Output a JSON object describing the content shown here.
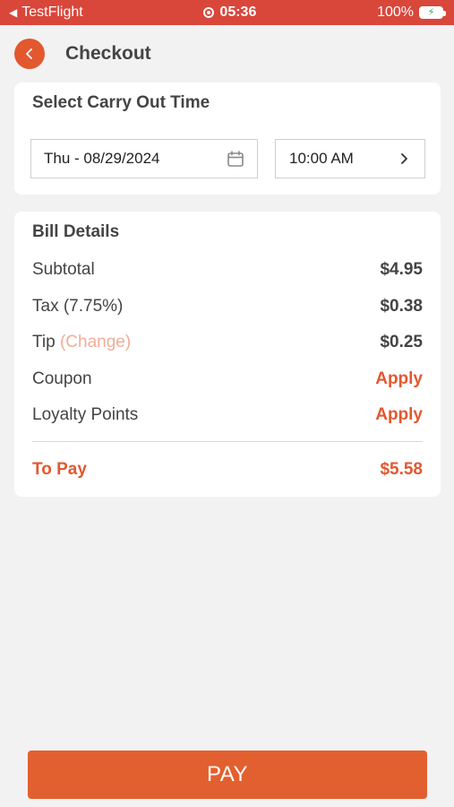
{
  "status_bar": {
    "back_app": "TestFlight",
    "time": "05:36",
    "battery": "100%"
  },
  "header": {
    "title": "Checkout"
  },
  "carry_out": {
    "title": "Select Carry Out Time",
    "date": "Thu - 08/29/2024",
    "time": "10:00 AM"
  },
  "bill": {
    "title": "Bill Details",
    "subtotal_label": "Subtotal",
    "subtotal_value": "$4.95",
    "tax_label": "Tax (7.75%)",
    "tax_value": "$0.38",
    "tip_label": "Tip",
    "tip_change": "(Change)",
    "tip_value": "$0.25",
    "coupon_label": "Coupon",
    "coupon_action": "Apply",
    "loyalty_label": "Loyalty Points",
    "loyalty_action": "Apply",
    "to_pay_label": "To Pay",
    "to_pay_value": "$5.58"
  },
  "pay_button": "PAY",
  "colors": {
    "accent": "#e2582f",
    "status_bar": "#d9463a",
    "background": "#f2f2f2"
  },
  "icons": [
    "back-arrow-icon",
    "record-icon",
    "battery-charging-icon",
    "calendar-icon",
    "chevron-right-icon"
  ]
}
